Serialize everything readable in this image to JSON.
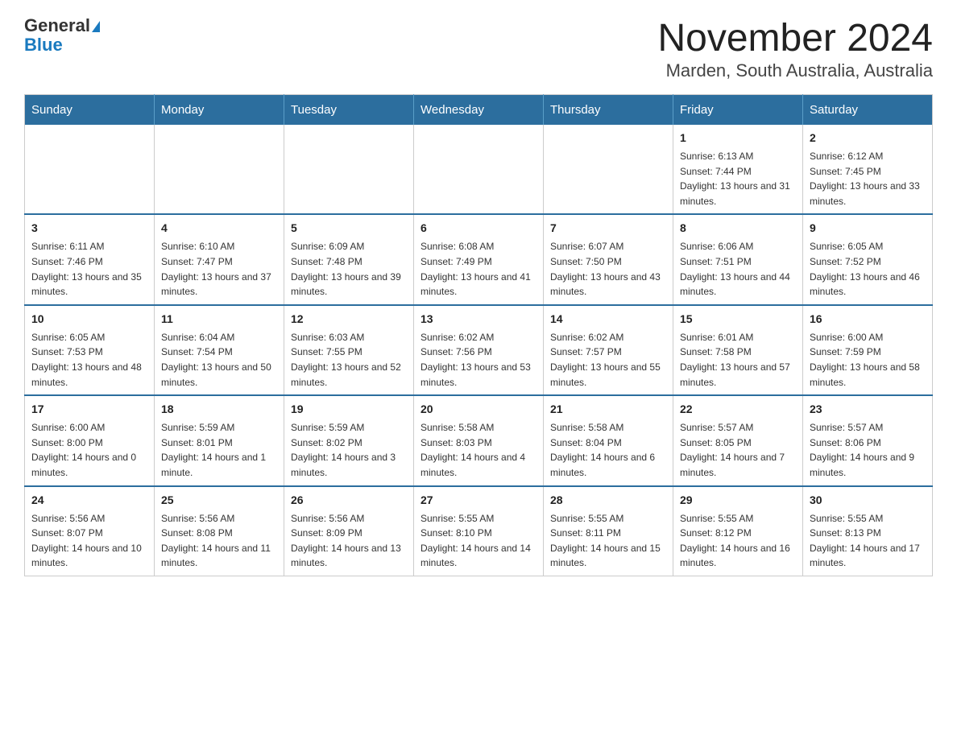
{
  "header": {
    "logo_line1": "General",
    "logo_line2": "Blue",
    "title": "November 2024",
    "subtitle": "Marden, South Australia, Australia"
  },
  "days_of_week": [
    "Sunday",
    "Monday",
    "Tuesday",
    "Wednesday",
    "Thursday",
    "Friday",
    "Saturday"
  ],
  "weeks": [
    [
      {
        "day": "",
        "info": ""
      },
      {
        "day": "",
        "info": ""
      },
      {
        "day": "",
        "info": ""
      },
      {
        "day": "",
        "info": ""
      },
      {
        "day": "",
        "info": ""
      },
      {
        "day": "1",
        "info": "Sunrise: 6:13 AM\nSunset: 7:44 PM\nDaylight: 13 hours and 31 minutes."
      },
      {
        "day": "2",
        "info": "Sunrise: 6:12 AM\nSunset: 7:45 PM\nDaylight: 13 hours and 33 minutes."
      }
    ],
    [
      {
        "day": "3",
        "info": "Sunrise: 6:11 AM\nSunset: 7:46 PM\nDaylight: 13 hours and 35 minutes."
      },
      {
        "day": "4",
        "info": "Sunrise: 6:10 AM\nSunset: 7:47 PM\nDaylight: 13 hours and 37 minutes."
      },
      {
        "day": "5",
        "info": "Sunrise: 6:09 AM\nSunset: 7:48 PM\nDaylight: 13 hours and 39 minutes."
      },
      {
        "day": "6",
        "info": "Sunrise: 6:08 AM\nSunset: 7:49 PM\nDaylight: 13 hours and 41 minutes."
      },
      {
        "day": "7",
        "info": "Sunrise: 6:07 AM\nSunset: 7:50 PM\nDaylight: 13 hours and 43 minutes."
      },
      {
        "day": "8",
        "info": "Sunrise: 6:06 AM\nSunset: 7:51 PM\nDaylight: 13 hours and 44 minutes."
      },
      {
        "day": "9",
        "info": "Sunrise: 6:05 AM\nSunset: 7:52 PM\nDaylight: 13 hours and 46 minutes."
      }
    ],
    [
      {
        "day": "10",
        "info": "Sunrise: 6:05 AM\nSunset: 7:53 PM\nDaylight: 13 hours and 48 minutes."
      },
      {
        "day": "11",
        "info": "Sunrise: 6:04 AM\nSunset: 7:54 PM\nDaylight: 13 hours and 50 minutes."
      },
      {
        "day": "12",
        "info": "Sunrise: 6:03 AM\nSunset: 7:55 PM\nDaylight: 13 hours and 52 minutes."
      },
      {
        "day": "13",
        "info": "Sunrise: 6:02 AM\nSunset: 7:56 PM\nDaylight: 13 hours and 53 minutes."
      },
      {
        "day": "14",
        "info": "Sunrise: 6:02 AM\nSunset: 7:57 PM\nDaylight: 13 hours and 55 minutes."
      },
      {
        "day": "15",
        "info": "Sunrise: 6:01 AM\nSunset: 7:58 PM\nDaylight: 13 hours and 57 minutes."
      },
      {
        "day": "16",
        "info": "Sunrise: 6:00 AM\nSunset: 7:59 PM\nDaylight: 13 hours and 58 minutes."
      }
    ],
    [
      {
        "day": "17",
        "info": "Sunrise: 6:00 AM\nSunset: 8:00 PM\nDaylight: 14 hours and 0 minutes."
      },
      {
        "day": "18",
        "info": "Sunrise: 5:59 AM\nSunset: 8:01 PM\nDaylight: 14 hours and 1 minute."
      },
      {
        "day": "19",
        "info": "Sunrise: 5:59 AM\nSunset: 8:02 PM\nDaylight: 14 hours and 3 minutes."
      },
      {
        "day": "20",
        "info": "Sunrise: 5:58 AM\nSunset: 8:03 PM\nDaylight: 14 hours and 4 minutes."
      },
      {
        "day": "21",
        "info": "Sunrise: 5:58 AM\nSunset: 8:04 PM\nDaylight: 14 hours and 6 minutes."
      },
      {
        "day": "22",
        "info": "Sunrise: 5:57 AM\nSunset: 8:05 PM\nDaylight: 14 hours and 7 minutes."
      },
      {
        "day": "23",
        "info": "Sunrise: 5:57 AM\nSunset: 8:06 PM\nDaylight: 14 hours and 9 minutes."
      }
    ],
    [
      {
        "day": "24",
        "info": "Sunrise: 5:56 AM\nSunset: 8:07 PM\nDaylight: 14 hours and 10 minutes."
      },
      {
        "day": "25",
        "info": "Sunrise: 5:56 AM\nSunset: 8:08 PM\nDaylight: 14 hours and 11 minutes."
      },
      {
        "day": "26",
        "info": "Sunrise: 5:56 AM\nSunset: 8:09 PM\nDaylight: 14 hours and 13 minutes."
      },
      {
        "day": "27",
        "info": "Sunrise: 5:55 AM\nSunset: 8:10 PM\nDaylight: 14 hours and 14 minutes."
      },
      {
        "day": "28",
        "info": "Sunrise: 5:55 AM\nSunset: 8:11 PM\nDaylight: 14 hours and 15 minutes."
      },
      {
        "day": "29",
        "info": "Sunrise: 5:55 AM\nSunset: 8:12 PM\nDaylight: 14 hours and 16 minutes."
      },
      {
        "day": "30",
        "info": "Sunrise: 5:55 AM\nSunset: 8:13 PM\nDaylight: 14 hours and 17 minutes."
      }
    ]
  ]
}
